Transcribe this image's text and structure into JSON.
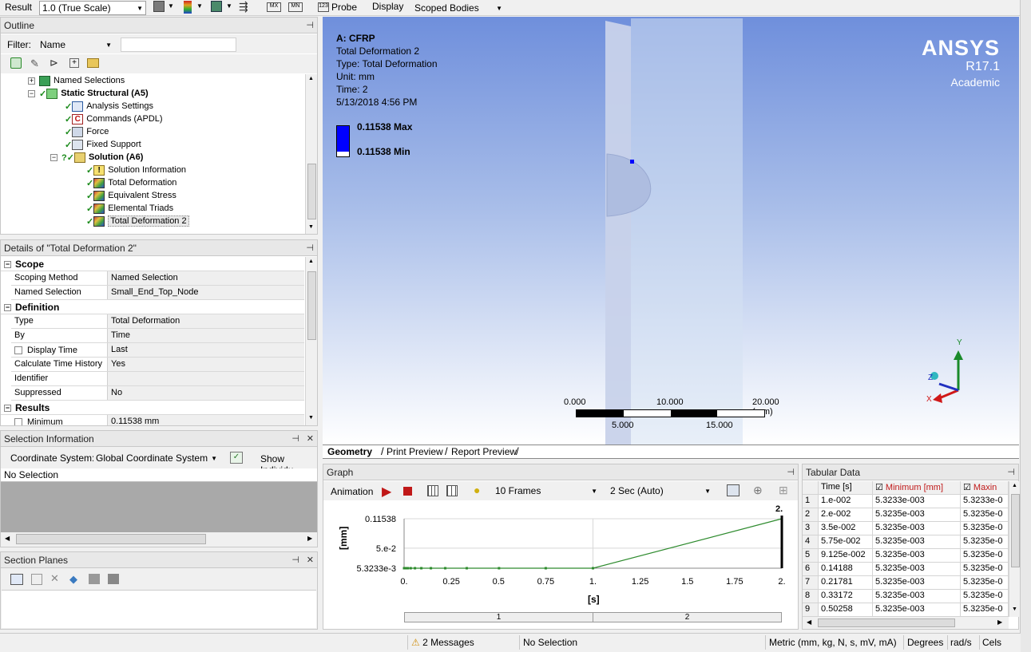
{
  "toolbar": {
    "result_label": "Result",
    "result_scale": "1.0 (True Scale)",
    "probe_label": "Probe",
    "display_label": "Display",
    "display_value": "Scoped Bodies"
  },
  "outline": {
    "title": "Outline",
    "filter_label": "Filter:",
    "filter_value": "Name",
    "tree": [
      {
        "label": "Named Selections",
        "icon": "named-selections-icon"
      },
      {
        "label": "Static Structural (A5)",
        "icon": "static-structural-icon"
      },
      {
        "label": "Analysis Settings",
        "icon": "analysis-settings-icon"
      },
      {
        "label": "Commands (APDL)",
        "icon": "commands-icon"
      },
      {
        "label": "Force",
        "icon": "force-icon"
      },
      {
        "label": "Fixed Support",
        "icon": "fixed-support-icon"
      },
      {
        "label": "Solution (A6)",
        "icon": "solution-icon"
      },
      {
        "label": "Solution Information",
        "icon": "solution-information-icon"
      },
      {
        "label": "Total Deformation",
        "icon": "result-icon"
      },
      {
        "label": "Equivalent Stress",
        "icon": "result-icon"
      },
      {
        "label": "Elemental Triads",
        "icon": "result-icon"
      },
      {
        "label": "Total Deformation 2",
        "icon": "result-icon"
      }
    ]
  },
  "details": {
    "title": "Details of \"Total Deformation 2\"",
    "sections": {
      "scope": "Scope",
      "definition": "Definition",
      "results": "Results"
    },
    "rows": {
      "scoping_method": {
        "label": "Scoping Method",
        "value": "Named Selection"
      },
      "named_selection": {
        "label": "Named Selection",
        "value": "Small_End_Top_Node"
      },
      "type": {
        "label": "Type",
        "value": "Total Deformation"
      },
      "by": {
        "label": "By",
        "value": "Time"
      },
      "display_time": {
        "label": "Display Time",
        "value": "Last"
      },
      "calc_history": {
        "label": "Calculate Time History",
        "value": "Yes"
      },
      "identifier": {
        "label": "Identifier",
        "value": ""
      },
      "suppressed": {
        "label": "Suppressed",
        "value": "No"
      },
      "minimum": {
        "label": "Minimum",
        "value": "0.11538 mm"
      }
    }
  },
  "selection_info": {
    "title": "Selection Information",
    "coord_label": "Coordinate System:",
    "coord_value": "Global Coordinate System",
    "show_label": "Show Individu",
    "no_selection": "No Selection"
  },
  "section_planes": {
    "title": "Section Planes"
  },
  "viewport": {
    "model": "A: CFRP",
    "result_name": "Total Deformation 2",
    "type_line": "Type: Total Deformation",
    "unit_line": "Unit: mm",
    "time_line": "Time: 2",
    "date_line": "5/13/2018 4:56 PM",
    "legend_max": "0.11538 Max",
    "legend_min": "0.11538 Min",
    "legend_color": "#0000ff",
    "logo": "ANSYS",
    "version": "R17.1",
    "edition": "Academic",
    "scale_top": [
      "0.000",
      "10.000",
      "20.000 (mm)"
    ],
    "scale_bottom": [
      "5.000",
      "15.000"
    ],
    "axis_x": "X",
    "axis_y": "Y",
    "axis_z": "Z",
    "tabs": [
      "Geometry",
      "Print Preview",
      "Report Preview"
    ]
  },
  "graph": {
    "title": "Graph",
    "animation_label": "Animation",
    "frames": "10 Frames",
    "duration": "2 Sec (Auto)",
    "ylabel": "[mm]",
    "xlabel": "[s]",
    "top_marker": "2.",
    "steps": [
      "1",
      "2"
    ]
  },
  "chart_data": {
    "type": "line",
    "title": "",
    "xlabel": "[s]",
    "ylabel": "[mm]",
    "xlim": [
      0,
      2
    ],
    "ylim": [
      0.0053233,
      0.11538
    ],
    "x_ticks": [
      "0.",
      "0.25",
      "0.5",
      "0.75",
      "1.",
      "1.25",
      "1.5",
      "1.75",
      "2."
    ],
    "y_ticks": [
      "5.3233e-3",
      "5.e-2",
      "0.11538"
    ],
    "series": [
      {
        "color": "#2e8b2e",
        "x": [
          0,
          0.01,
          0.02,
          0.035,
          0.0575,
          0.09125,
          0.14188,
          0.21781,
          0.33172,
          0.50258,
          0.75,
          1.0,
          2.0
        ],
        "y": [
          0.0053233,
          0.0053233,
          0.0053235,
          0.0053235,
          0.0053235,
          0.0053235,
          0.0053235,
          0.0053235,
          0.0053235,
          0.0053235,
          0.0053235,
          0.0053235,
          0.11538
        ]
      }
    ]
  },
  "tabular": {
    "title": "Tabular Data",
    "headers": [
      "Time [s]",
      "Minimum [mm]",
      "Maxin"
    ],
    "rows": [
      [
        "1",
        "1.e-002",
        "5.3233e-003",
        "5.3233e-0"
      ],
      [
        "2",
        "2.e-002",
        "5.3235e-003",
        "5.3235e-0"
      ],
      [
        "3",
        "3.5e-002",
        "5.3235e-003",
        "5.3235e-0"
      ],
      [
        "4",
        "5.75e-002",
        "5.3235e-003",
        "5.3235e-0"
      ],
      [
        "5",
        "9.125e-002",
        "5.3235e-003",
        "5.3235e-0"
      ],
      [
        "6",
        "0.14188",
        "5.3235e-003",
        "5.3235e-0"
      ],
      [
        "7",
        "0.21781",
        "5.3235e-003",
        "5.3235e-0"
      ],
      [
        "8",
        "0.33172",
        "5.3235e-003",
        "5.3235e-0"
      ],
      [
        "9",
        "0.50258",
        "5.3235e-003",
        "5.3235e-0"
      ]
    ]
  },
  "statusbar": {
    "messages": "2 Messages",
    "selection": "No Selection",
    "units": "Metric (mm, kg, N, s, mV, mA)",
    "angle": "Degrees",
    "rate": "rad/s",
    "temp": "Cels"
  }
}
